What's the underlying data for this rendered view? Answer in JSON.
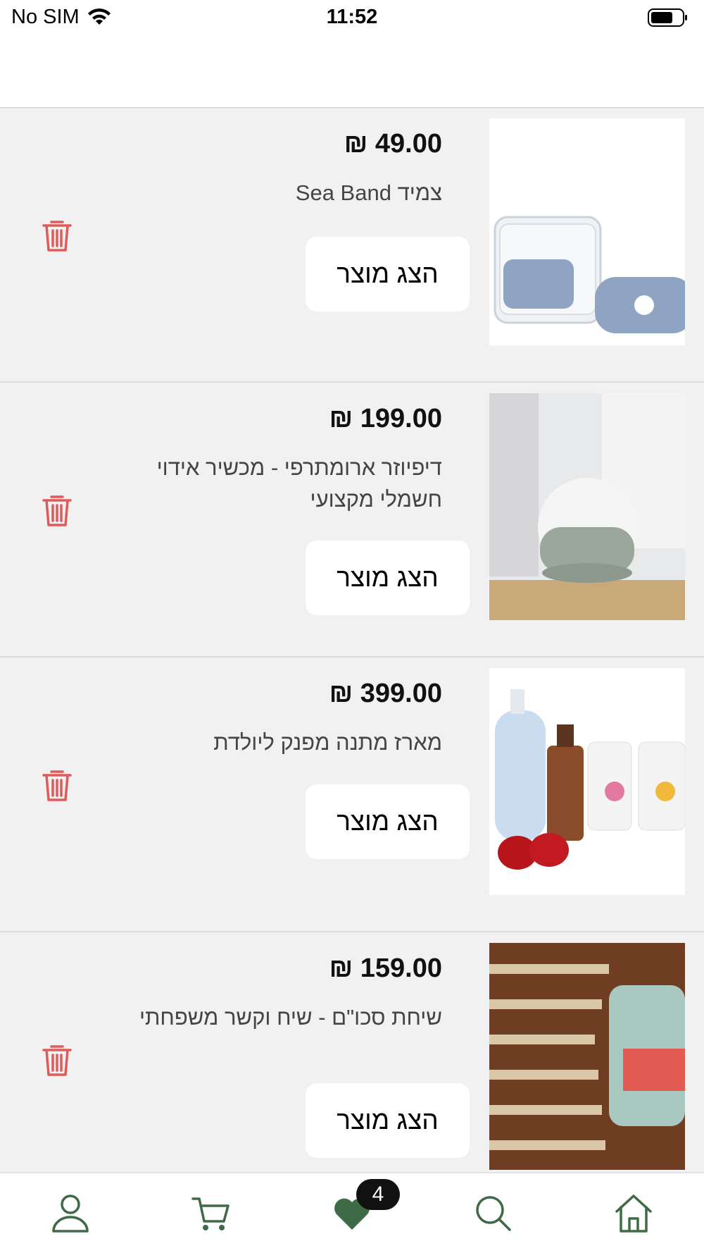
{
  "status_bar": {
    "carrier": "No SIM",
    "time": "11:52"
  },
  "items": [
    {
      "price": "₪ 49.00",
      "title": "צמיד Sea Band",
      "button": "הצג מוצר",
      "image": "sea-band-image"
    },
    {
      "price": "₪ 199.00",
      "title": "דיפיוזר ארומתרפי - מכשיר אידוי חשמלי מקצועי",
      "button": "הצג מוצר",
      "image": "diffuser-image"
    },
    {
      "price": "₪ 399.00",
      "title": "מארז מתנה מפנק ליולדת",
      "button": "הצג מוצר",
      "image": "gift-box-image"
    },
    {
      "price": "₪ 159.00",
      "title": "שיחת סכו\"ם - שיח וקשר משפחתי",
      "button": "הצג מוצר",
      "image": "cutlery-image"
    }
  ],
  "tabbar": {
    "favorites_count": "4",
    "accent": "#3e6b46"
  },
  "colors": {
    "trash": "#e05a5a",
    "list_bg": "#f1f1f1"
  }
}
